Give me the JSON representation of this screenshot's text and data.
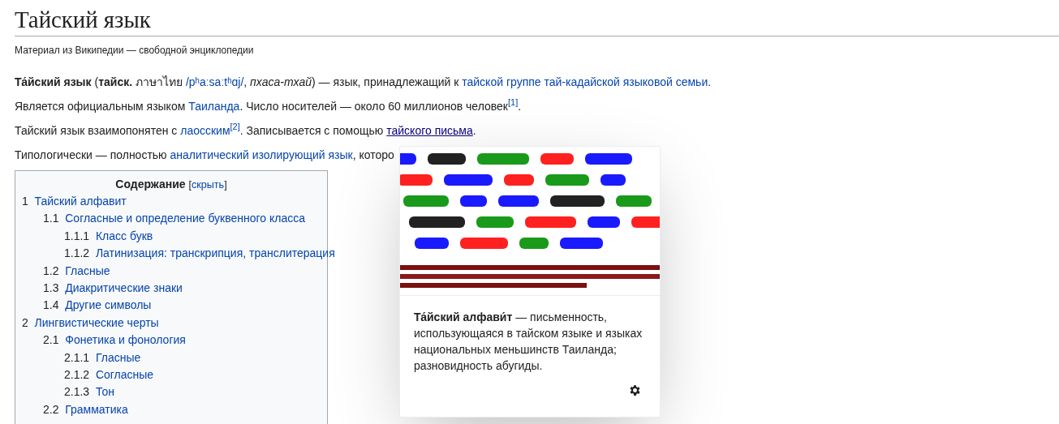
{
  "title": "Тайский язык",
  "subtitle": "Материал из Википедии — свободной энциклопедии",
  "paragraphs": [
    [
      {
        "kind": "bold",
        "text": "Та́йский язык"
      },
      {
        "kind": "text",
        "text": " ("
      },
      {
        "kind": "bold",
        "text": "тайск."
      },
      {
        "kind": "text",
        "text": " ภาษาไทย "
      },
      {
        "kind": "link",
        "text": "/pʰaːsaːtʰɑj/"
      },
      {
        "kind": "text",
        "text": ", "
      },
      {
        "kind": "italic",
        "text": "пхаса-тхай"
      },
      {
        "kind": "text",
        "text": ") — язык, принадлежащий к "
      },
      {
        "kind": "link",
        "text": "тайской группе "
      },
      {
        "kind": "link",
        "text": "тай-кадайской языковой семьи"
      },
      {
        "kind": "text",
        "text": "."
      }
    ],
    [
      {
        "kind": "text",
        "text": "Является официальным языком "
      },
      {
        "kind": "link",
        "text": "Таиланда"
      },
      {
        "kind": "text",
        "text": ". Число носителей — около 60 миллионов человек"
      },
      {
        "kind": "ref",
        "text": "[1]"
      },
      {
        "kind": "text",
        "text": "."
      }
    ],
    [
      {
        "kind": "text",
        "text": "Тайский язык взаимопонятен с "
      },
      {
        "kind": "link",
        "text": "лаосским"
      },
      {
        "kind": "ref",
        "text": "[2]"
      },
      {
        "kind": "text",
        "text": ". Записывается с помощью "
      },
      {
        "kind": "hovered_link",
        "text": "тайского письма"
      },
      {
        "kind": "text",
        "text": "."
      }
    ],
    [
      {
        "kind": "text",
        "text": "Типологически — полностью "
      },
      {
        "kind": "link",
        "text": "аналитический изолирующий язык"
      },
      {
        "kind": "text",
        "text": ", которо"
      }
    ]
  ],
  "toc": {
    "title": "Содержание",
    "toggle_open": "[",
    "toggle": "скрыть",
    "toggle_close": "]",
    "items": [
      {
        "number": "1",
        "label": "Тайский алфавит",
        "children": [
          {
            "number": "1.1",
            "label": "Согласные и определение буквенного класса",
            "children": [
              {
                "number": "1.1.1",
                "label": "Класс букв"
              },
              {
                "number": "1.1.2",
                "label": "Латинизация: транскрипция, транслитерация"
              }
            ]
          },
          {
            "number": "1.2",
            "label": "Гласные"
          },
          {
            "number": "1.3",
            "label": "Диакритические знаки"
          },
          {
            "number": "1.4",
            "label": "Другие символы"
          }
        ]
      },
      {
        "number": "2",
        "label": "Лингвистические черты",
        "children": [
          {
            "number": "2.1",
            "label": "Фонетика и фонология",
            "children": [
              {
                "number": "2.1.1",
                "label": "Гласные"
              },
              {
                "number": "2.1.2",
                "label": "Согласные"
              },
              {
                "number": "2.1.3",
                "label": "Тон"
              }
            ]
          },
          {
            "number": "2.2",
            "label": "Грамматика"
          }
        ]
      }
    ]
  },
  "preview": {
    "text": "**Та́йский алфави́т** — письменность, использующаяся в тайском языке и языках национальных меньшинств Таиланда; разновидность абугиды."
  }
}
